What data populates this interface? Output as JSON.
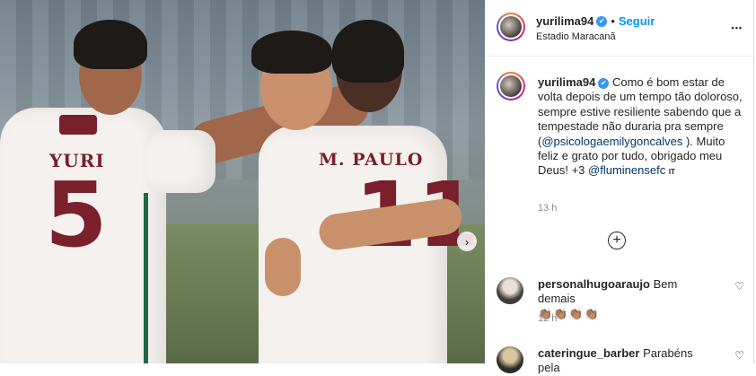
{
  "post": {
    "username": "yurilima94",
    "verified_glyph": "✔",
    "separator": "•",
    "follow_label": "Seguir",
    "location": "Estadio Maracanã",
    "more_glyph": "•••"
  },
  "photo": {
    "shirt_left_name": "YURI",
    "shirt_left_number": "5",
    "shirt_right_name": "M. PAULO",
    "shirt_right_number": "11",
    "next_glyph": "›"
  },
  "caption": {
    "username": "yurilima94",
    "text_before_mention": "Como é bom estar de volta depois de um tempo tão doloroso, sempre estive resiliente sabendo que a tempestade não duraria pra sempre (",
    "mention1": "@psicologaemilygoncalves",
    "text_after_mention": " ). Muito feliz e grato por tudo, obrigado meu Deus! +3 ",
    "mention2": "@fluminensefc",
    "tr_label": "IT",
    "time": "13 h"
  },
  "add_glyph": "+",
  "comments": [
    {
      "username": "personalhugoaraujo",
      "text": "Bem demais",
      "emoji": "👏🏽👏🏽👏🏽👏🏽",
      "time": "12 h",
      "heart": "♡"
    },
    {
      "username": "cateringue_barber",
      "text": "Parabéns pela",
      "heart": "♡"
    }
  ]
}
